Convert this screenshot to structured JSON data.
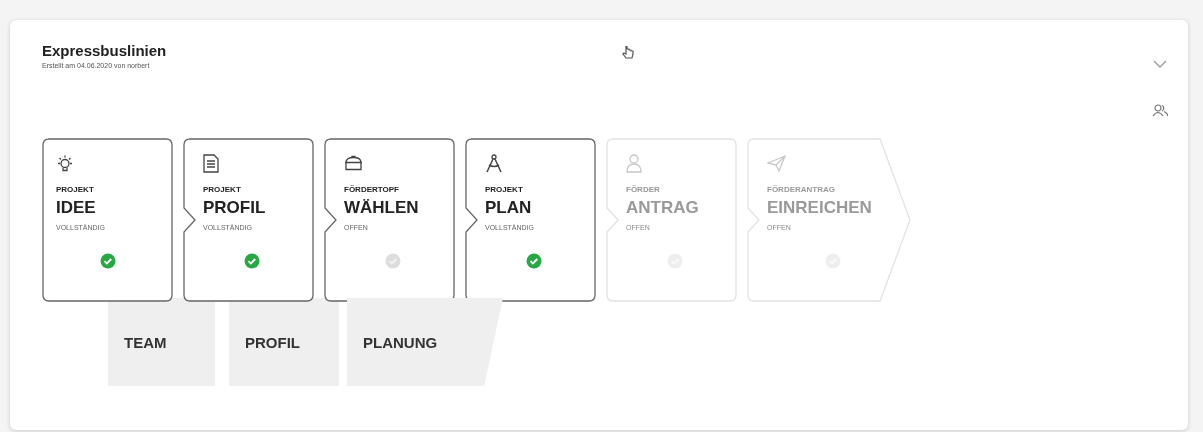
{
  "title": "Expressbuslinien",
  "subtitle": "Erstellt am 04.06.2020 von norbert",
  "steps": [
    {
      "kind": "bulb",
      "category": "PROJEKT",
      "name": "IDEE",
      "status": "VOLLSTÄNDIG",
      "complete": true,
      "disabled": false
    },
    {
      "kind": "document",
      "category": "PROJEKT",
      "name": "PROFIL",
      "status": "VOLLSTÄNDIG",
      "complete": true,
      "disabled": false
    },
    {
      "kind": "pot",
      "category": "FÖRDERTOPF",
      "name": "WÄHLEN",
      "status": "OFFEN",
      "complete": false,
      "disabled": false
    },
    {
      "kind": "compass",
      "category": "PROJEKT",
      "name": "PLAN",
      "status": "VOLLSTÄNDIG",
      "complete": true,
      "disabled": false
    },
    {
      "kind": "person",
      "category": "FÖRDER",
      "name": "ANTRAG",
      "status": "OFFEN",
      "complete": false,
      "disabled": true
    },
    {
      "kind": "plane",
      "category": "FÖRDERANTRAG",
      "name": "EINREICHEN",
      "status": "OFFEN",
      "complete": false,
      "disabled": true
    }
  ],
  "tabs": [
    {
      "label": "TEAM"
    },
    {
      "label": "PROFIL"
    },
    {
      "label": "PLANUNG"
    }
  ]
}
